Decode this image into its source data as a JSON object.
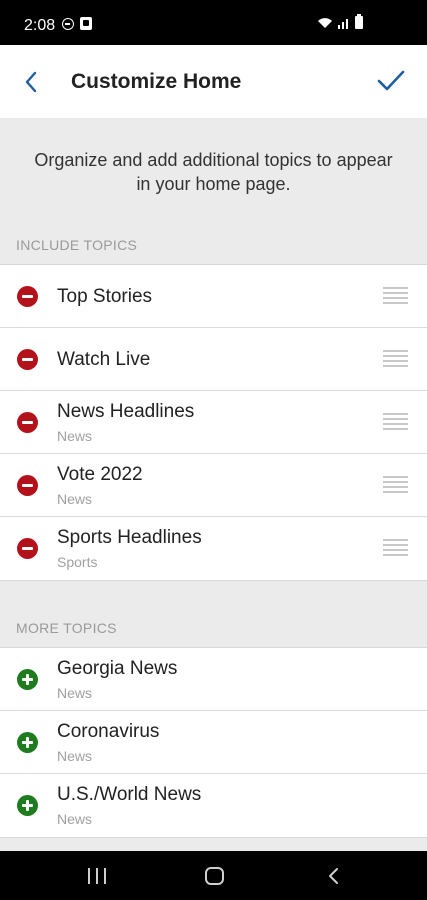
{
  "status_bar": {
    "time": "2:08",
    "icons": [
      "do-not-disturb-icon",
      "app-notification-icon",
      "wifi-icon",
      "signal-icon",
      "battery-icon"
    ]
  },
  "header": {
    "title": "Customize Home",
    "back_icon": "chevron-left-icon",
    "confirm_icon": "checkmark-icon",
    "accent_color": "#1f5e9e"
  },
  "intro": {
    "text": "Organize and add additional topics to appear in your home page."
  },
  "include_topics": {
    "header": "INCLUDE TOPICS",
    "items": [
      {
        "title": "Top Stories",
        "subtitle": ""
      },
      {
        "title": "Watch Live",
        "subtitle": ""
      },
      {
        "title": "News Headlines",
        "subtitle": "News"
      },
      {
        "title": "Vote 2022",
        "subtitle": "News"
      },
      {
        "title": "Sports Headlines",
        "subtitle": "Sports"
      }
    ],
    "action_icon": "remove-circle-icon",
    "action_color": "#b3121b"
  },
  "more_topics": {
    "header": "MORE TOPICS",
    "items": [
      {
        "title": "Georgia News",
        "subtitle": "News"
      },
      {
        "title": "Coronavirus",
        "subtitle": "News"
      },
      {
        "title": "U.S./World News",
        "subtitle": "News"
      }
    ],
    "action_icon": "add-circle-icon",
    "action_color": "#1e7b1e"
  },
  "nav_bar": {
    "icons": [
      "recent-apps-icon",
      "home-icon",
      "back-icon"
    ]
  }
}
